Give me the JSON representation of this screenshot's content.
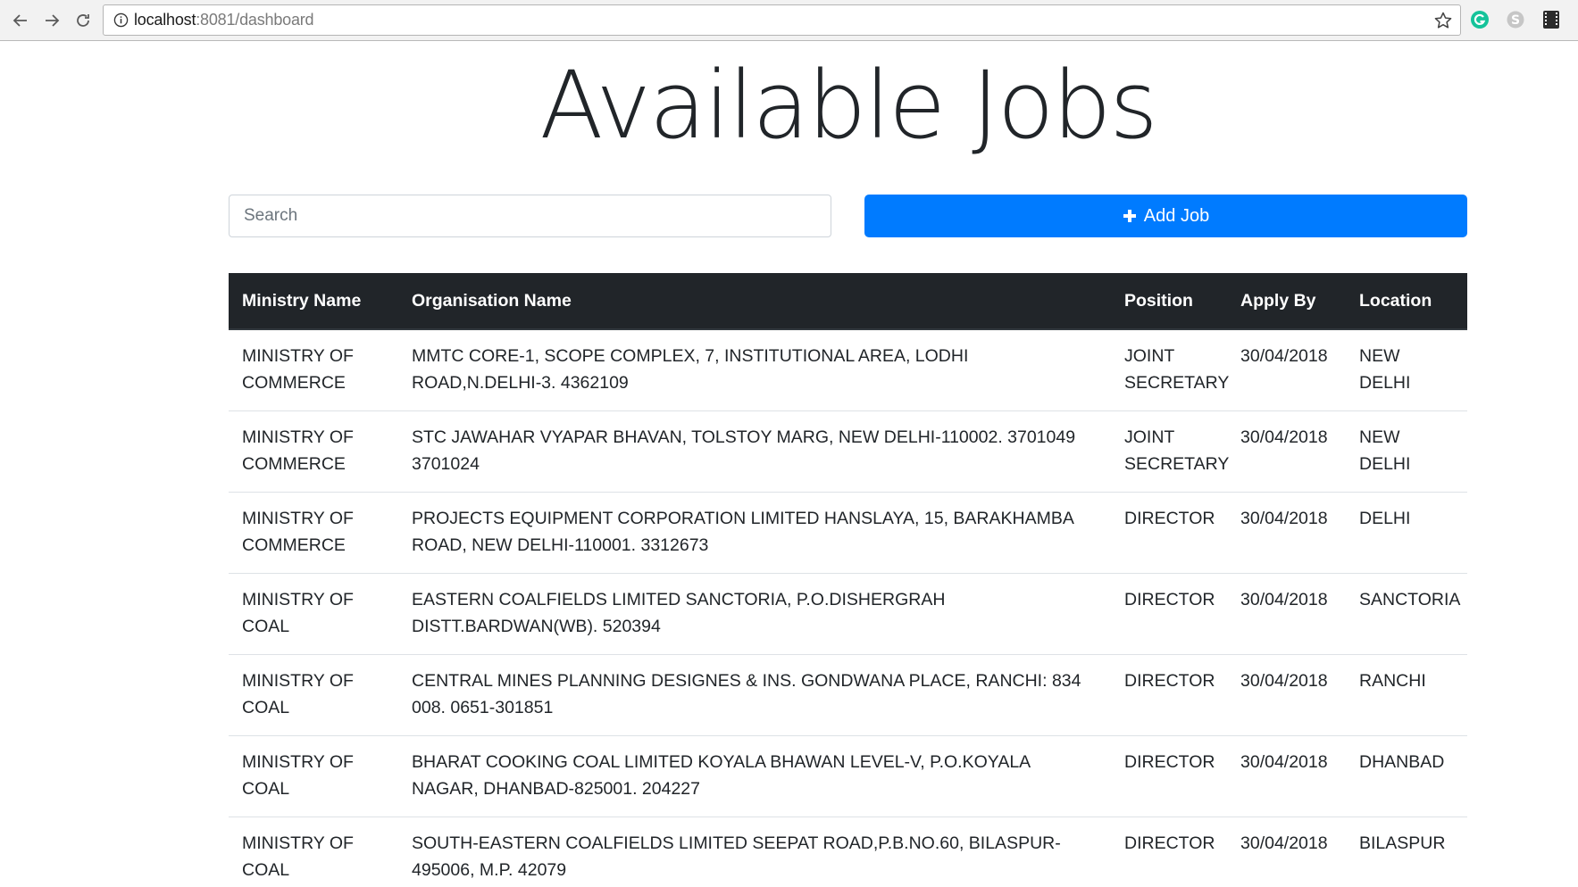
{
  "browser": {
    "url_host": "localhost",
    "url_rest": ":8081/dashboard",
    "icons": [
      "back-arrow-icon",
      "forward-arrow-icon",
      "reload-icon",
      "info-icon",
      "star-icon",
      "grammarly-icon",
      "skype-icon",
      "film-icon"
    ]
  },
  "page": {
    "title": "Available Jobs",
    "search_placeholder": "Search",
    "search_value": "",
    "add_button_label": "Add Job",
    "accent_color": "#007bff",
    "header_bg": "#212529"
  },
  "table": {
    "headers": [
      "Ministry Name",
      "Organisation Name",
      "Position",
      "Apply By",
      "Location"
    ],
    "rows": [
      {
        "ministry": "MINISTRY OF COMMERCE",
        "organisation": "MMTC CORE-1, SCOPE COMPLEX, 7, INSTITUTIONAL AREA, LODHI ROAD,N.DELHI-3. 4362109",
        "position": "JOINT SECRETARY",
        "apply_by": "30/04/2018",
        "location": "NEW DELHI"
      },
      {
        "ministry": "MINISTRY OF COMMERCE",
        "organisation": "STC JAWAHAR VYAPAR BHAVAN, TOLSTOY MARG, NEW DELHI-110002. 3701049 3701024",
        "position": "JOINT SECRETARY",
        "apply_by": "30/04/2018",
        "location": "NEW DELHI"
      },
      {
        "ministry": "MINISTRY OF COMMERCE",
        "organisation": "PROJECTS EQUIPMENT CORPORATION LIMITED HANSLAYA, 15, BARAKHAMBA ROAD, NEW DELHI-110001. 3312673",
        "position": "DIRECTOR",
        "apply_by": "30/04/2018",
        "location": "DELHI"
      },
      {
        "ministry": "MINISTRY OF COAL",
        "organisation": "EASTERN COALFIELDS LIMITED SANCTORIA, P.O.DISHERGRAH DISTT.BARDWAN(WB). 520394",
        "position": "DIRECTOR",
        "apply_by": "30/04/2018",
        "location": "SANCTORIA"
      },
      {
        "ministry": "MINISTRY OF COAL",
        "organisation": "CENTRAL MINES PLANNING DESIGNES & INS. GONDWANA PLACE, RANCHI: 834 008. 0651-301851",
        "position": "DIRECTOR",
        "apply_by": "30/04/2018",
        "location": "RANCHI"
      },
      {
        "ministry": "MINISTRY OF COAL",
        "organisation": "BHARAT COOKING COAL LIMITED KOYALA BHAWAN LEVEL-V, P.O.KOYALA NAGAR, DHANBAD-825001. 204227",
        "position": "DIRECTOR",
        "apply_by": "30/04/2018",
        "location": "DHANBAD"
      },
      {
        "ministry": "MINISTRY OF COAL",
        "organisation": "SOUTH-EASTERN COALFIELDS LIMITED SEEPAT ROAD,P.B.NO.60, BILASPUR-495006, M.P. 42079",
        "position": "DIRECTOR",
        "apply_by": "30/04/2018",
        "location": "BILASPUR"
      }
    ]
  }
}
